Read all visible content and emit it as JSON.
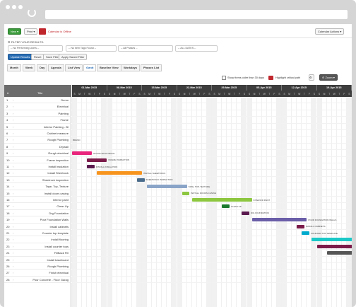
{
  "toolbar": {
    "new_label": "New",
    "print_label": "Print",
    "calendar_label": "Calendar is Offline",
    "actions_label": "Calendar Actions"
  },
  "filters": {
    "title": "FILTER YOUR RESULTS:",
    "performing_users": "-- No Performing Users --",
    "item_tags": "-- No Item Tags Found --",
    "phases": "-- All Phases --",
    "dates": "-- ALL DATES --",
    "update_label": "Update Results",
    "reset_label": "Reset",
    "save_label": "Save Filter",
    "apply_label": "Apply Saved Filter"
  },
  "tabs": [
    "Month",
    "Week",
    "Day",
    "Agenda",
    "List View",
    "Gantt",
    "Baseline View",
    "Workdays",
    "Phases List"
  ],
  "active_tab": 5,
  "options": {
    "show_older": "Show items older than 30 days",
    "critical_path": "Highlight critical path",
    "zoom_label": "Zoom"
  },
  "grid_header": {
    "col_num": "#",
    "col_title": "Title"
  },
  "weeks": [
    "01-Mar 2015",
    "08-Mar 2015",
    "15-Mar 2015",
    "22-Mar 2015",
    "29-Mar 2015",
    "05-Apr 2015",
    "12-Apr 2015",
    "19-Apr 2015"
  ],
  "day_letters": [
    "S",
    "M",
    "T",
    "W",
    "T",
    "F",
    "S"
  ],
  "tasks": [
    {
      "n": "1",
      "title": "Demo",
      "bar": null
    },
    {
      "n": "2",
      "title": "Electrical",
      "bar": null
    },
    {
      "n": "3",
      "title": "Painting",
      "bar": null
    },
    {
      "n": "4",
      "title": "Frame",
      "bar": null
    },
    {
      "n": "5",
      "title": "Interior Painting - Bl",
      "bar": null
    },
    {
      "n": "6",
      "title": "Cabinet measure",
      "bar": null
    },
    {
      "n": "7",
      "title": "Rough Plumbing",
      "bar": null,
      "label": "BRAND"
    },
    {
      "n": "8",
      "title": "Drywall",
      "bar": null
    },
    {
      "n": "9",
      "title": "Rough electrical",
      "color": "#e8247c",
      "start": 0,
      "dur": 4,
      "label": "ROUGH ELECTRICAL"
    },
    {
      "n": "10",
      "title": "Frame inspection",
      "color": "#7b1b4a",
      "start": 3,
      "dur": 4,
      "label": "FRAME INSPECTION"
    },
    {
      "n": "11",
      "title": "Install insulation",
      "color": "#5b1a4f",
      "start": 3,
      "dur": 1.5,
      "label": "INSTALL INSULATION"
    },
    {
      "n": "12",
      "title": "Install Sheetrock",
      "color": "#f7941d",
      "start": 5,
      "dur": 9,
      "label": "INSTALL SHEETROCK"
    },
    {
      "n": "13",
      "title": "Sheetrock inspection",
      "color": "#4a6c8c",
      "start": 13,
      "dur": 1.5,
      "label": "SHEETROCK INSPECTION"
    },
    {
      "n": "14",
      "title": "Tape, Top, Texture",
      "color": "#8aa4c8",
      "start": 15,
      "dur": 8,
      "label": "TAPE, TOP, TEXTURE"
    },
    {
      "n": "15",
      "title": "Install doors casing",
      "color": "#8dc63f",
      "start": 22,
      "dur": 1.5,
      "label": "INSTALL DOORS CASING"
    },
    {
      "n": "16",
      "title": "Interior paint",
      "color": "#8dc63f",
      "start": 24,
      "dur": 12,
      "label": "INTERIOR PAINT"
    },
    {
      "n": "17",
      "title": "Clean Up",
      "color": "#1c7a2e",
      "start": 30,
      "dur": 1.5,
      "label": "CLEAN UP"
    },
    {
      "n": "18",
      "title": "Drg Foundation",
      "color": "#5b1a4f",
      "start": 34,
      "dur": 1.5,
      "label": "DIG FOUNDATION"
    },
    {
      "n": "19",
      "title": "Pour Foundation Walls",
      "color": "#6b5ea8",
      "start": 36,
      "dur": 11,
      "label": "POUR FOUNDATION WALLS"
    },
    {
      "n": "20",
      "title": "Install cabinets",
      "color": "#7b1b4a",
      "start": 45,
      "dur": 1.5,
      "label": "INSTALL CABINETS"
    },
    {
      "n": "21",
      "title": "Counter top template",
      "color": "#00aacc",
      "start": 46,
      "dur": 1.5,
      "label": "COUNTER TOP TEMPLATE"
    },
    {
      "n": "22",
      "title": "Install flooring",
      "color": "#1bc8c8",
      "start": 48,
      "dur": 11,
      "label": "INSTALL FLOORING"
    },
    {
      "n": "23",
      "title": "Install counter tops",
      "color": "#7b1b4a",
      "start": 49,
      "dur": 8,
      "label": "INSTALL COUNTER TOPS"
    },
    {
      "n": "24",
      "title": "FillBack Fill",
      "color": "#555555",
      "start": 51,
      "dur": 9,
      "label": "FILLBACK FILL"
    },
    {
      "n": "25",
      "title": "Install baseboard",
      "color": "#9a3e8c",
      "start": 58,
      "dur": 5,
      "label": "INSTALL BASEBOARD"
    },
    {
      "n": "26",
      "title": "Rough Plumbing",
      "color": "#8dc63f",
      "start": 61,
      "dur": 8,
      "label": "ROUGH PLUMBING"
    },
    {
      "n": "27",
      "title": "Finish electrical",
      "color": "#333333",
      "start": 64,
      "dur": 6,
      "label": "FINISH"
    },
    {
      "n": "28",
      "title": "Pour Concrete - Floor Garag",
      "color": "#e8247c",
      "start": 66,
      "dur": 6,
      "label": "POUR CONCRETE"
    }
  ]
}
